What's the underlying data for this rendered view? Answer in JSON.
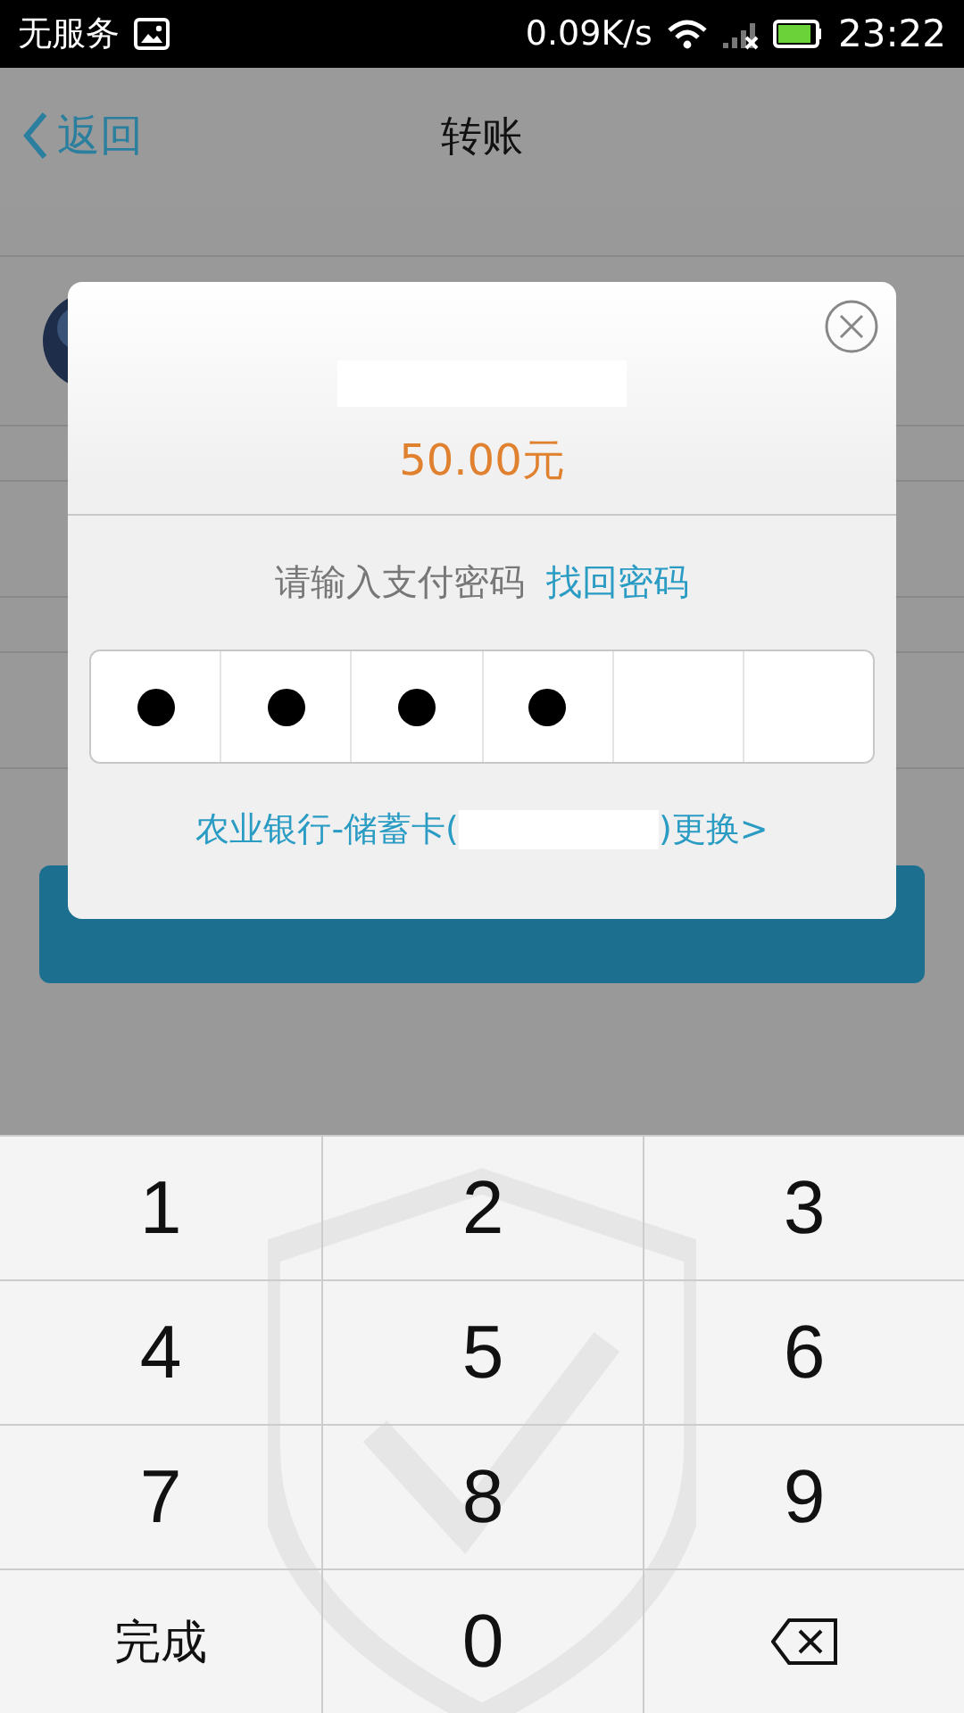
{
  "status_bar": {
    "carrier": "无服务",
    "speed": "0.09K/s",
    "time": "23:22"
  },
  "nav_bar": {
    "back": "返回",
    "title": "转账"
  },
  "form": {
    "rows": [
      {
        "kind": "avatar"
      },
      {
        "kind": "field"
      },
      {
        "kind": "field"
      }
    ]
  },
  "dialog": {
    "amount": "50.00元",
    "prompt": "请输入支付密码",
    "recover_link": "找回密码",
    "pin": [
      {
        "filled": true
      },
      {
        "filled": true
      },
      {
        "filled": true
      },
      {
        "filled": true
      },
      {
        "filled": false
      },
      {
        "filled": false
      }
    ],
    "card_prefix": "农业银行-储蓄卡(",
    "card_suffix": ")更换>"
  },
  "keypad": [
    {
      "kind": "digit",
      "label": "1"
    },
    {
      "kind": "digit",
      "label": "2"
    },
    {
      "kind": "digit",
      "label": "3"
    },
    {
      "kind": "digit",
      "label": "4"
    },
    {
      "kind": "digit",
      "label": "5"
    },
    {
      "kind": "digit",
      "label": "6"
    },
    {
      "kind": "digit",
      "label": "7"
    },
    {
      "kind": "digit",
      "label": "8"
    },
    {
      "kind": "digit",
      "label": "9"
    },
    {
      "kind": "done",
      "label": "完成"
    },
    {
      "kind": "digit",
      "label": "0"
    },
    {
      "kind": "delete"
    }
  ]
}
